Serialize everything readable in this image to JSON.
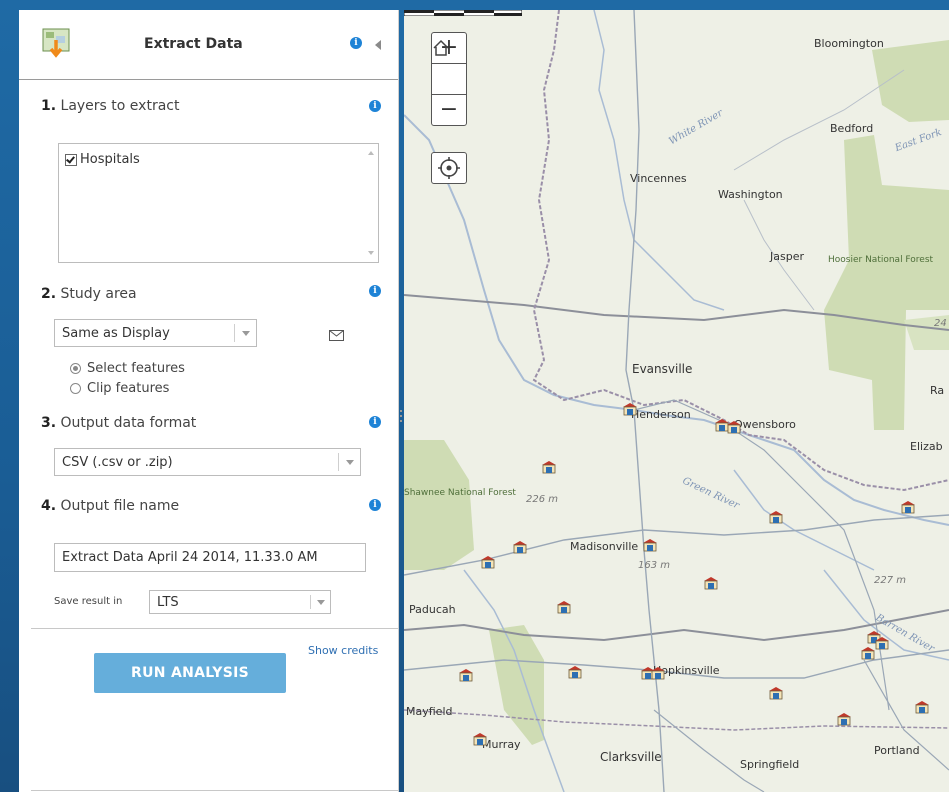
{
  "panel": {
    "title": "Extract Data",
    "step1": {
      "num": "1.",
      "label": "Layers to extract",
      "layers": [
        "Hospitals"
      ]
    },
    "step2": {
      "num": "2.",
      "label": "Study area",
      "area_value": "Same as Display",
      "options": [
        "Select features",
        "Clip features"
      ],
      "selected_option": "Select features"
    },
    "step3": {
      "num": "3.",
      "label": "Output data format",
      "format_value": "CSV (.csv or .zip)"
    },
    "step4": {
      "num": "4.",
      "label": "Output file name",
      "file_name": "Extract Data April 24 2014, 11.33.0 AM",
      "save_label": "Save result in",
      "save_value": "LTS"
    },
    "credits_link": "Show credits",
    "run_button": "RUN ANALYSIS"
  },
  "map": {
    "zoom_in": "+",
    "zoom_out": "−",
    "places": [
      "Bloomington",
      "Bedford",
      "Vincennes",
      "Washington",
      "Jasper",
      "Evansville",
      "Henderson",
      "Owensboro",
      "Madisonville",
      "Paducah",
      "Hopkinsville",
      "Mayfield",
      "Murray",
      "Clarksville",
      "Springfield",
      "Portland",
      "Ra",
      "Elizab"
    ],
    "forests": [
      "Hoosier National Forest",
      "Shawnee National Forest"
    ],
    "rivers": [
      "White River",
      "Green River",
      "Barren River",
      "East Fork"
    ],
    "elevations": [
      "226 m",
      "163 m",
      "227 m",
      "24"
    ],
    "colors": {
      "land": "#eef0e6",
      "forest": "#cfdcb4",
      "state_line": "#8c8f99",
      "road": "#8a9bb0",
      "panel_button": "#65aedb",
      "info_icon": "#1e83d6"
    }
  }
}
